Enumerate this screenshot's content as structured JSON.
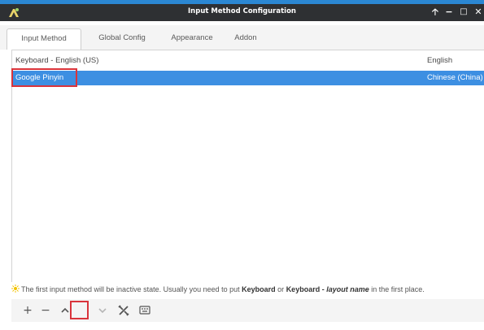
{
  "window": {
    "title": "Input Method Configuration",
    "controls": {
      "minimize": "−",
      "maximize": "□",
      "close": "✕",
      "pin": "🡡"
    }
  },
  "tabs": [
    {
      "label": "Input Method",
      "active": true
    },
    {
      "label": "Global Config",
      "active": false
    },
    {
      "label": "Appearance",
      "active": false
    },
    {
      "label": "Addon",
      "active": false
    }
  ],
  "input_methods": [
    {
      "name": "Keyboard - English (US)",
      "language": "English",
      "selected": false
    },
    {
      "name": "Google Pinyin",
      "language": "Chinese (China)",
      "selected": true
    }
  ],
  "hint": {
    "text_1": "The first input method will be inactive state. Usually you need to put ",
    "bold_1": "Keyboard",
    "text_2": " or ",
    "bold_2": "Keyboard - ",
    "italic_1": "layout name",
    "text_3": " in the first place."
  },
  "toolbar": {
    "add": "+",
    "remove": "−",
    "move_up": "⌃",
    "move_down": "⌄",
    "configure_icon": "tools-icon",
    "keyboard_icon": "keyboard-icon"
  },
  "colors": {
    "selection": "#3d8fe2",
    "highlight_annotation": "#d9343b",
    "titlebar": "#2e3033",
    "titlebar_accent": "#2b87d3"
  }
}
